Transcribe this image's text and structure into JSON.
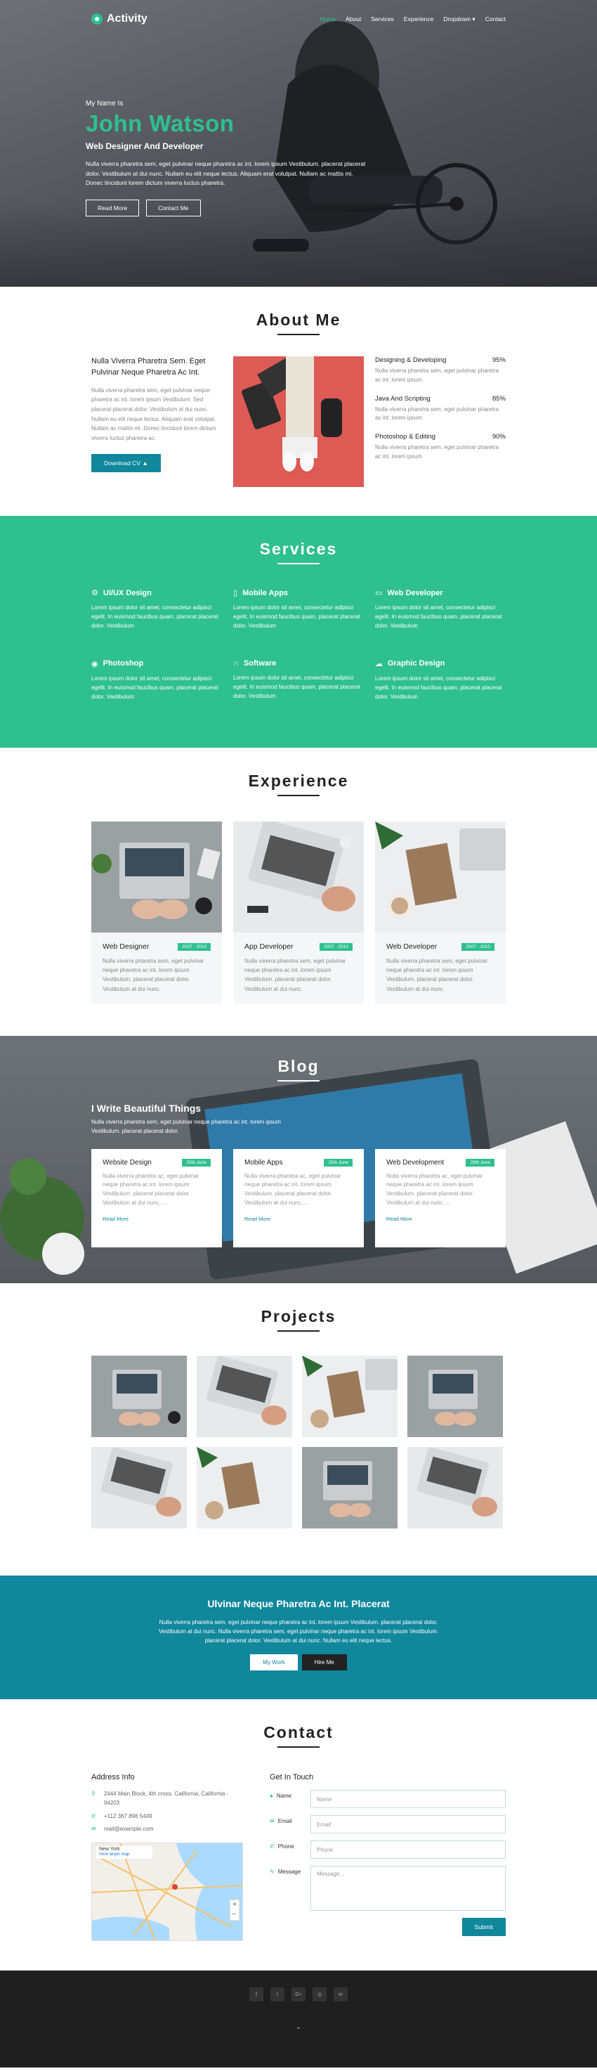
{
  "nav": {
    "logo": "Activity",
    "items": [
      "Home",
      "About",
      "Services",
      "Experience",
      "Dropdown ▾",
      "Contact"
    ]
  },
  "hero": {
    "greeting": "My Name Is",
    "name": "John Watson",
    "role": "Web Designer And Developer",
    "text": "Nulla viverra pharetra sem, eget pulvinar neque pharetra ac int. lorem ipsum Vestibulum. placerat placerat dolor. Vestibulum at dui nunc. Nullam eu elit neque lectus. Aliquam erat volutpat. Nullam ac mattis mi. Donec tincidunt lorem dictum viverra luctus pharetra.",
    "btn_read": "Read More",
    "btn_contact": "Contact Me"
  },
  "about": {
    "title": "About Me",
    "heading": "Nulla Viverra Pharetra Sem. Eget Pulvinar Neque Pharetra Ac Int.",
    "text": "Nulla viverra pharetra sem, eget pulvinar neque pharetra ac int. lorem ipsum Vestibulum. Sed placerat placerat dolor. Vestibulum at dui nunc. Nullam eu elit neque lectus. Aliquam erat volutpat. Nullam ac mattis mi. Donec tincidunt lorem dictum viverra luctus pharetra ac.",
    "btn": "Download CV",
    "skills": [
      {
        "name": "Designing & Developing",
        "pct": "95%",
        "text": "Nulla viverra pharetra sem, eget pulvinar pharetra ac int. lorem ipsum"
      },
      {
        "name": "Java And Scripting",
        "pct": "85%",
        "text": "Nulla viverra pharetra sem, eget pulvinar pharetra ac int. lorem ipsum"
      },
      {
        "name": "Photoshop & Editing",
        "pct": "90%",
        "text": "Nulla viverra pharetra sem, eget pulvinar pharetra ac int. lorem ipsum"
      }
    ]
  },
  "services": {
    "title": "Services",
    "items": [
      {
        "icon": "cogs-icon",
        "glyph": "⚙",
        "name": "UI/UX Design",
        "text": "Lorem ipsum dolor sit amet, consectetur adipisci egelit. In euismod faucibus quam, placerat placerat dolor. Vestibulum"
      },
      {
        "icon": "mobile-icon",
        "glyph": "▯",
        "name": "Mobile Apps",
        "text": "Lorem ipsum dolor sit amet, consectetur adipisci egelit. In euismod faucibus quam, placerat placerat dolor. Vestibulum"
      },
      {
        "icon": "laptop-icon",
        "glyph": "▭",
        "name": "Web Developer",
        "text": "Lorem ipsum dolor sit amet, consectetur adipisci egelit. In euismod faucibus quam, placerat placerat dolor. Vestibulum"
      },
      {
        "icon": "camera-icon",
        "glyph": "◉",
        "name": "Photoshop",
        "text": "Lorem ipsum dolor sit amet, consectetur adipisci egelit. In euismod faucibus quam, placerat placerat dolor. Vestibulum"
      },
      {
        "icon": "headphones-icon",
        "glyph": "∩",
        "name": "Software",
        "text": "Lorem ipsum dolor sit amet, consectetur adipisci egelit. In euismod faucibus quam, placerat placerat dolor. Vestibulum"
      },
      {
        "icon": "cloud-icon",
        "glyph": "☁",
        "name": "Graphic Design",
        "text": "Lorem ipsum dolor sit amet, consectetur adipisci egelit. In euismod faucibus quam, placerat placerat dolor. Vestibulum"
      }
    ]
  },
  "experience": {
    "title": "Experience",
    "items": [
      {
        "name": "Web Designer",
        "years": "2007 - 2010",
        "text": "Nulla viverra pharetra sem, eget pulvinar neque pharetra ac int. lorem ipsum Vestibulum. placerat placerat dolor. Vestibulum at dui nunc."
      },
      {
        "name": "App Developer",
        "years": "2007 - 2010",
        "text": "Nulla viverra pharetra sem, eget pulvinar neque pharetra ac int. lorem ipsum Vestibulum. placerat placerat dolor. Vestibulum at dui nunc."
      },
      {
        "name": "Web Developer",
        "years": "2007 - 2010",
        "text": "Nulla viverra pharetra sem, eget pulvinar neque pharetra ac int. lorem ipsum Vestibulum. placerat placerat dolor. Vestibulum at dui nunc."
      }
    ]
  },
  "blog": {
    "title": "Blog",
    "heading": "I Write Beautiful Things",
    "text": "Nulla viverra pharetra sem, eget pulvinar neque pharetra ac int. lorem ipsum Vestibulum. placerat placerat dolor.",
    "posts": [
      {
        "name": "Website Design",
        "date": "25th June",
        "text": "Nulla viverra pharetra ac, eget pulvinar neque pharetra ac int. lorem ipsum Vestibulum. placerat placerat dolor. Vestibulum at dui nunc.....",
        "link": "Read More"
      },
      {
        "name": "Mobile Apps",
        "date": "25th June",
        "text": "Nulla viverra pharetra ac, eget pulvinar neque pharetra ac int. lorem ipsum Vestibulum. placerat placerat dolor. Vestibulum at dui nunc.....",
        "link": "Read More"
      },
      {
        "name": "Web Development",
        "date": "25th June",
        "text": "Nulla viverra pharetra ac, eget pulvinar neque pharetra ac int. lorem ipsum Vestibulum. placerat placerat dolor. Vestibulum at dui nunc.....",
        "link": "Read More"
      }
    ]
  },
  "projects": {
    "title": "Projects"
  },
  "cta": {
    "heading": "Ulvinar Neque Pharetra Ac Int. Placerat",
    "text": "Nulla viverra pharetra sem, eget pulvinar neque pharetra ac int. lorem ipsum Vestibulum. placerat placerat dolor. Vestibulum at dui nunc. Nulla viverra pharetra sem, eget pulvinar neque pharetra ac int. lorem ipsum Vestibulum. placerat placerat dolor. Vestibulum at dui nunc. Nullam eu elit neque lectus.",
    "btn_work": "My Work",
    "btn_hire": "Hire Me"
  },
  "contact": {
    "title": "Contact",
    "address_heading": "Address Info",
    "address": "2444 Main Block, 4th cross, California, California - 94203",
    "phone": "+112 367 896 5449",
    "email": "mail@example.com",
    "map_label": "New York",
    "map_link": "View larger map",
    "form_heading": "Get In Touch",
    "label_name": "Name",
    "label_email": "Email",
    "label_phone": "Phone",
    "label_message": "Message",
    "ph_name": "Name",
    "ph_email": "Email",
    "ph_phone": "Phone",
    "ph_message": "Message...",
    "btn_submit": "Submit"
  },
  "footer": {
    "social": [
      "f",
      "t",
      "G+",
      "◎",
      "in"
    ],
    "up": "⌃"
  },
  "colors": {
    "accent": "#2ec08f",
    "teal": "#11879c",
    "footer": "#1f1f1f"
  }
}
